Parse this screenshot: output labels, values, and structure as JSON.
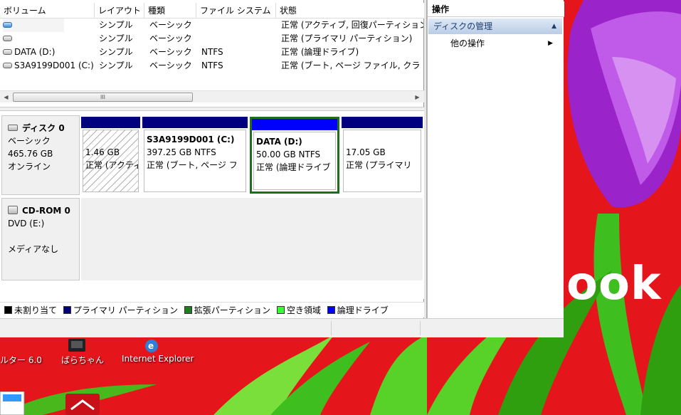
{
  "volume_list": {
    "columns": [
      "ボリューム",
      "レイアウト",
      "種類",
      "ファイル システム",
      "状態"
    ],
    "rows": [
      {
        "volume": "",
        "layout": "シンプル",
        "type": "ベーシック",
        "fs": "",
        "status": "正常 (アクティブ, 回復パーティション)",
        "icon": "blue-drive-icon"
      },
      {
        "volume": "",
        "layout": "シンプル",
        "type": "ベーシック",
        "fs": "",
        "status": "正常 (プライマリ パーティション)",
        "icon": "drive-icon"
      },
      {
        "volume": "DATA (D:)",
        "layout": "シンプル",
        "type": "ベーシック",
        "fs": "NTFS",
        "status": "正常 (論理ドライブ)",
        "icon": "drive-icon"
      },
      {
        "volume": "S3A9199D001 (C:)",
        "layout": "シンプル",
        "type": "ベーシック",
        "fs": "NTFS",
        "status": "正常 (ブート, ページ ファイル, クラ",
        "icon": "drive-icon"
      }
    ],
    "scroll_thumb_glyph": "III"
  },
  "disk0": {
    "title": "ディスク 0",
    "type": "ベーシック",
    "size": "465.76 GB",
    "state": "オンライン",
    "partitions": [
      {
        "name": "",
        "size": "1.46 GB",
        "status": "正常 (アクティ",
        "kind": "primary"
      },
      {
        "name": "S3A9199D001 (C:)",
        "size": "397.25 GB NTFS",
        "status": "正常 (ブート, ページ フ",
        "kind": "primary"
      },
      {
        "name": "DATA (D:)",
        "size": "50.00 GB NTFS",
        "status": "正常 (論理ドライブ",
        "kind": "logical"
      },
      {
        "name": "",
        "size": "17.05 GB",
        "status": "正常 (プライマリ",
        "kind": "primary"
      }
    ]
  },
  "cdrom0": {
    "title": "CD-ROM 0",
    "drive": "DVD (E:)",
    "media": "メディアなし"
  },
  "legend": [
    {
      "label": "未割り当て",
      "color": "#000000"
    },
    {
      "label": "プライマリ パーティション",
      "color": "#00007f"
    },
    {
      "label": "拡張パーティション",
      "color": "#1e7d1e"
    },
    {
      "label": "空き領域",
      "color": "#33ff33"
    },
    {
      "label": "論理ドライブ",
      "color": "#0000ff"
    }
  ],
  "actions": {
    "title": "操作",
    "section": "ディスクの管理",
    "item": "他の操作"
  },
  "desktop": {
    "icons": [
      {
        "label": "ルター 6.0"
      },
      {
        "label": "ばらちゃん"
      },
      {
        "label": "Internet Explorer"
      }
    ],
    "wallpaper_word": "ook"
  },
  "colors": {
    "primary_bar": "#00007f",
    "logical_bar": "#0000ff",
    "selected_border": "#1e6e1e",
    "desktop_bg": "#e4161c"
  }
}
